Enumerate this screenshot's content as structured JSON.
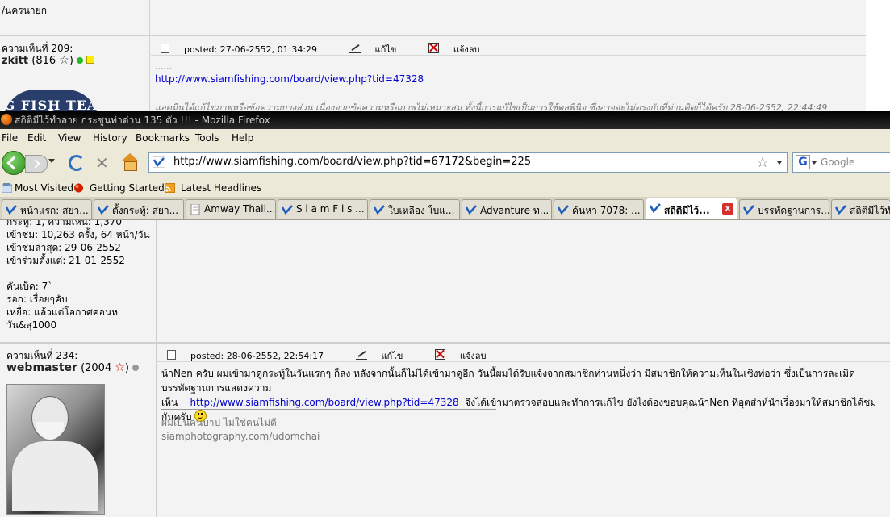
{
  "background_page": {
    "top_left_text": "/นครนายก",
    "post": {
      "comment_label": "ความเห็นที่ 209:",
      "username": "zkitt",
      "points": "(816",
      "posted": "posted:  27-06-2552,  01:34:29",
      "edit_label": "แก้ไข",
      "report_label": "แจ้งลบ",
      "ellipsis": "......",
      "link": "http://www.siamfishing.com/board/view.php?tid=47328",
      "edit_note": "แอดมินได้แก้ไขภาพหรือข้อความบางส่วน  เนื่องจากข้อความหรือภาพไม่เหมาะสม  ทั้งนี้การแก้ไขเป็นการใช้ดุลพินิจ  ซึ่งอาจจะไม่ตรงกับที่ท่านคิดก็ได้ครับ  28-06-2552, 22:44:49",
      "logo_text": "G FISH TEA"
    }
  },
  "browser": {
    "window_title": "สถิติมีไว้ทำลาย กระชูนท่าด่าน 135 ตัว !!! - Mozilla Firefox",
    "menu": [
      "File",
      "Edit",
      "View",
      "History",
      "Bookmarks",
      "Tools",
      "Help"
    ],
    "url": "http://www.siamfishing.com/board/view.php?tid=67172&begin=225",
    "search_placeholder": "Google",
    "search_engine_letter": "G",
    "bookmarks": [
      "Most Visited",
      "Getting Started",
      "Latest Headlines"
    ],
    "tabs": [
      {
        "label": "หน้าแรก: สยา..."
      },
      {
        "label": "ตั้งกระทู้: สยา..."
      },
      {
        "label": "Amway Thail..."
      },
      {
        "label": "S i a m F i s ..."
      },
      {
        "label": "ใบเหลือง ใบแ..."
      },
      {
        "label": "Advanture ท..."
      },
      {
        "label": "ค้นหา 7078: ..."
      },
      {
        "label": "สถิติมีไว้...",
        "active": true
      },
      {
        "label": "บรรทัดฐานการ..."
      },
      {
        "label": "สถิติมีไว้ทำ"
      }
    ],
    "close_glyph": "x"
  },
  "content": {
    "prev_user_stats": [
      "กระทู้: 1, ความเห็น: 1,370",
      "เข้าชม: 10,263 ครั้ง, 64 หน้า/วัน",
      "เข้าชมล่าสุด: 29-06-2552",
      "เข้าร่วมตั้งแต่: 21-01-2552",
      "",
      "คันเบ็ด: 7`",
      "รอก: เรื่อยๆคับ",
      "เหยื่อ: แล้วแต่โอกาศคอนหวัน&สุ1000"
    ],
    "post": {
      "comment_label": "ความเห็นที่ 234:",
      "username": "webmaster",
      "points": "(2004",
      "posted": "posted:  28-06-2552,  22:54:17",
      "edit_label": "แก้ไข",
      "report_label": "แจ้งลบ",
      "body_1": "น้าNen ครับ ผมเข้ามาดูกระทู้ในวันแรกๆ ก็ลง หลังจากนั้นก็ไม่ได้เข้ามาดูอีก วันนี้ผมได้รับแจ้งจากสมาชิกท่านหนึ่งว่า มีสมาชิกให้ความเห็นในเชิงท่อว่า ซึ่งเป็นการละเมิดบรรทัดฐานการแสดงความ",
      "body_2_prefix": "เห็น",
      "body_link": "http://www.siamfishing.com/board/view.php?tid=47328",
      "body_2_suffix": "จึงได้เข้ามาตรวจสอบและทำการแก้ไข ยังไงต้องขอบคุณน้าNen ที่อุตส่าห์นำเรื่องมาให้สมาชิกได้ชมกันครับ",
      "signature_line1": "ผมเป็นคนบาป ไม่ใช่คนไม่ดี",
      "signature_line2": "siamphotography.com/udomchai"
    }
  },
  "colors": {
    "link": "#0000cc",
    "titlebar": "#000000",
    "chrome": "#ece9d8",
    "post_bg": "#f3f3f3"
  }
}
